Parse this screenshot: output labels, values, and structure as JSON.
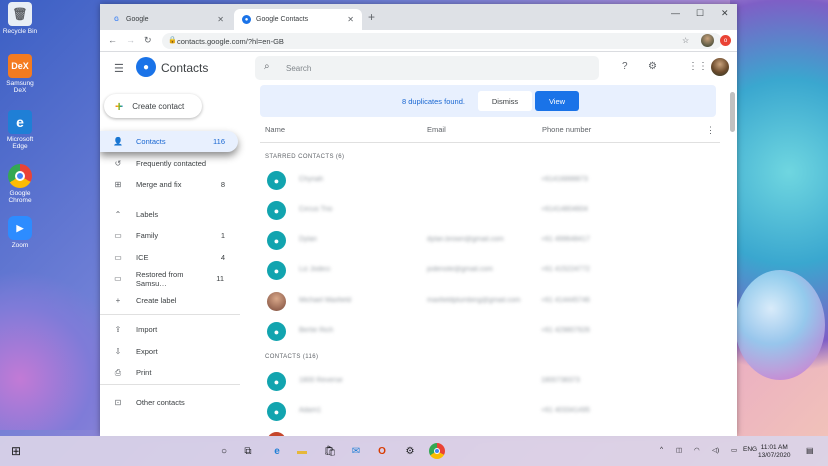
{
  "desktop": {
    "icons": [
      {
        "label": "Recycle Bin",
        "icon": "recycle-bin-icon",
        "color": "#e8eef5"
      },
      {
        "label": "Samsung DeX",
        "icon": "dex-icon",
        "glyph": "DeX",
        "color": "#f47b20"
      },
      {
        "label": "Microsoft Edge",
        "icon": "edge-icon",
        "glyph": "e",
        "color": "#1f7fd6"
      },
      {
        "label": "Google Chrome",
        "icon": "chrome-icon",
        "color": "#34a853"
      },
      {
        "label": "Zoom",
        "icon": "zoom-icon",
        "color": "#2d8cff"
      }
    ]
  },
  "browser": {
    "tabs": [
      {
        "title": "Google",
        "icon": "google-g-icon"
      },
      {
        "title": "Google Contacts",
        "icon": "contacts-icon"
      }
    ],
    "url": "contacts.google.com/?hl=en-GB"
  },
  "app": {
    "title": "Contacts",
    "search_placeholder": "Search",
    "create_label": "Create contact",
    "nav": [
      {
        "label": "Contacts",
        "count": "116",
        "icon": "person-icon",
        "selected": true
      },
      {
        "label": "Frequently contacted",
        "count": "",
        "icon": "history-icon"
      },
      {
        "label": "Merge and fix",
        "count": "8",
        "icon": "merge-icon"
      }
    ],
    "labels_header": "Labels",
    "labels": [
      {
        "label": "Family",
        "count": "1"
      },
      {
        "label": "ICE",
        "count": "4"
      },
      {
        "label": "Restored from Samsu…",
        "count": "11"
      }
    ],
    "create_label_link": "Create label",
    "tools": [
      {
        "label": "Import",
        "icon": "upload-icon"
      },
      {
        "label": "Export",
        "icon": "download-icon"
      },
      {
        "label": "Print",
        "icon": "print-icon"
      }
    ],
    "other_contacts": "Other contacts"
  },
  "banner": {
    "message": "8 duplicates found.",
    "dismiss": "Dismiss",
    "view": "View"
  },
  "columns": {
    "name": "Name",
    "email": "Email",
    "phone": "Phone number"
  },
  "starred_header": "STARRED CONTACTS (6)",
  "starred": [
    {
      "name": "Chynah",
      "email": "",
      "phone": "+61416888873"
    },
    {
      "name": "Circus Trio",
      "email": "",
      "phone": "+61414804604"
    },
    {
      "name": "Dylan",
      "email": "dylan.brown@gmail.com",
      "phone": "+61 499648417"
    },
    {
      "name": "Liz Jodeci",
      "email": "jodenote@gmail.com",
      "phone": "+61 415224772"
    },
    {
      "name": "Michael Maxfield",
      "email": "maxfieldplumbing@gmail.com",
      "phone": "+61 414445746"
    },
    {
      "name": "Bertie Rich",
      "email": "",
      "phone": "+61 429807926"
    }
  ],
  "contacts_header": "CONTACTS (116)",
  "contacts": [
    {
      "name": "1800 Reverse",
      "email": "",
      "phone": "1800738373"
    },
    {
      "name": "Adam1",
      "email": "",
      "phone": "+61 403341495"
    }
  ],
  "taskbar": {
    "language": "ENG",
    "time": "11:01 AM",
    "date": "13/07/2020"
  }
}
